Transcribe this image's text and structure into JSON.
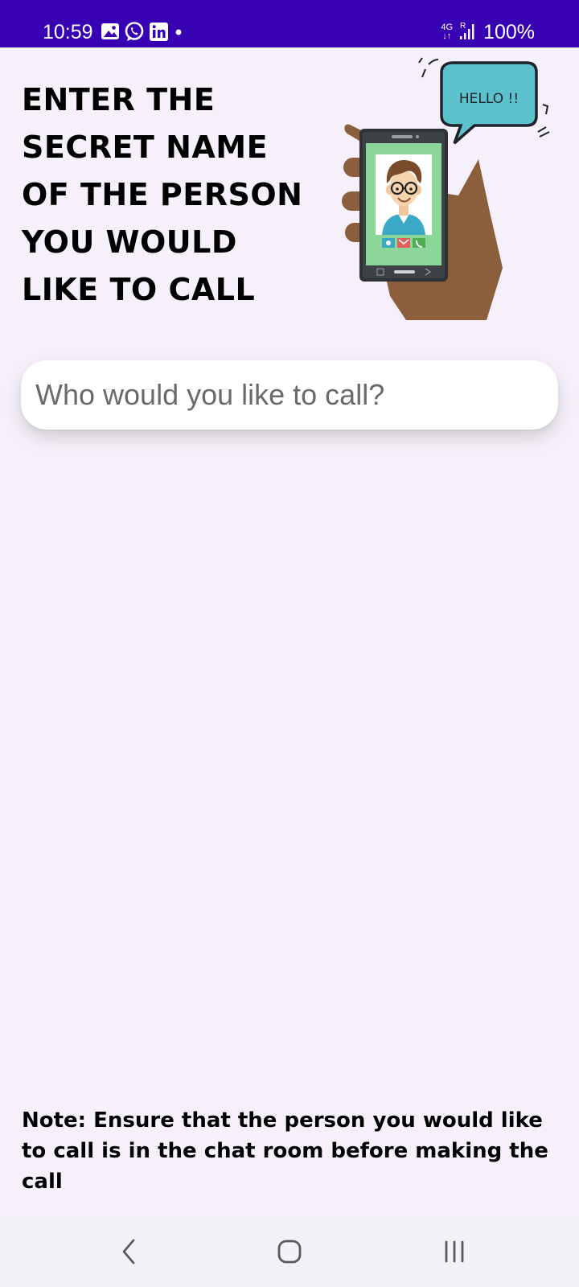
{
  "status_bar": {
    "time": "10:59",
    "network_type": "4G",
    "roaming": "R",
    "battery": "100%",
    "notification_icons": [
      "gallery-icon",
      "whatsapp-icon",
      "linkedin-icon",
      "dot-icon"
    ],
    "background": "#3700b3"
  },
  "header": {
    "title_lines": [
      "ENTER THE",
      "SECRET NAME",
      "OF THE PERSON",
      "YOU WOULD",
      "LIKE TO CALL"
    ]
  },
  "illustration": {
    "bubble_text": "HELLO !!"
  },
  "search": {
    "placeholder": "Who would you like to call?",
    "value": ""
  },
  "note": {
    "text": "Note: Ensure that the person you would like to call is in the chat room before making the call"
  },
  "nav_bar": {
    "buttons": [
      "back-icon",
      "home-icon",
      "recents-icon"
    ]
  }
}
